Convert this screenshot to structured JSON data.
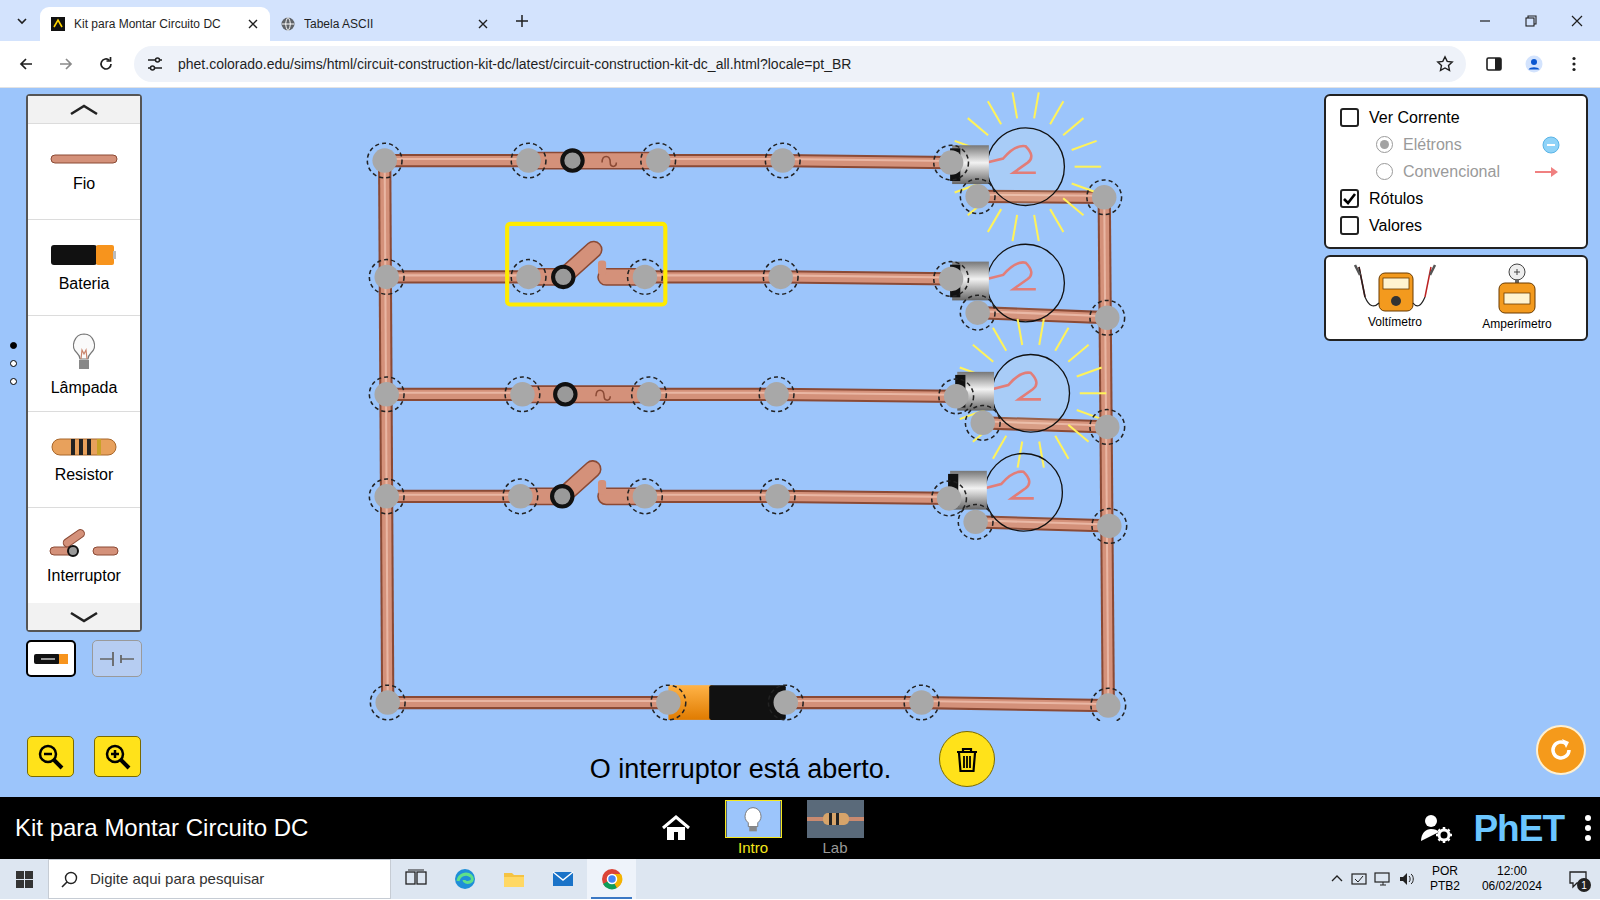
{
  "window": {
    "title": "Kit para Montar Circuito DC"
  },
  "tabs": [
    {
      "label": "Kit para Montar Circuito DC",
      "selected": true,
      "kind": "phet"
    },
    {
      "label": "Tabela ASCII",
      "selected": false,
      "kind": "globe"
    }
  ],
  "address_bar": {
    "url": "phet.colorado.edu/sims/html/circuit-construction-kit-dc/latest/circuit-construction-kit-dc_all.html?locale=pt_BR",
    "bookmarked": false
  },
  "toolbox": {
    "items": [
      {
        "label": "Fio",
        "kind": "wire"
      },
      {
        "label": "Bateria",
        "kind": "battery"
      },
      {
        "label": "Lâmpada",
        "kind": "bulb"
      },
      {
        "label": "Resistor",
        "kind": "resistor"
      },
      {
        "label": "Interruptor",
        "kind": "switch"
      }
    ],
    "pages": [
      {
        "selected": true
      },
      {
        "selected": false
      },
      {
        "selected": false
      }
    ],
    "views": [
      {
        "kind": "lifelike",
        "selected": true
      },
      {
        "kind": "schematic",
        "selected": false
      }
    ]
  },
  "circuit": {
    "branches": [
      {
        "switch_closed": true,
        "switch_selected": false,
        "bulb_lit": true
      },
      {
        "switch_closed": false,
        "switch_selected": true,
        "bulb_lit": false
      },
      {
        "switch_closed": true,
        "switch_selected": false,
        "bulb_lit": true
      },
      {
        "switch_closed": false,
        "switch_selected": false,
        "bulb_lit": false
      }
    ]
  },
  "status": "O interruptor está aberto.",
  "controls": {
    "show_current": {
      "label": "Ver Corrente",
      "checked": false
    },
    "current_types": [
      {
        "label": "Elétrons",
        "selected": true,
        "disabled": true,
        "kind": "electron"
      },
      {
        "label": "Convencional",
        "selected": false,
        "disabled": true,
        "kind": "conventional"
      }
    ],
    "checkboxes": [
      {
        "label": "Rótulos",
        "checked": true
      },
      {
        "label": "Valores",
        "checked": false
      }
    ]
  },
  "meters": [
    {
      "label": "Voltímetro",
      "kind": "voltmeter"
    },
    {
      "label": "Amperímetro",
      "kind": "ammeter"
    }
  ],
  "sim_navbar": {
    "title": "Kit para Montar Circuito DC",
    "screens": [
      {
        "label": "Intro",
        "selected": true,
        "kind": "intro"
      },
      {
        "label": "Lab",
        "selected": false,
        "kind": "lab"
      }
    ],
    "logo": "PhET"
  },
  "taskbar": {
    "search_placeholder": "Digite aqui para pesquisar",
    "apps": [
      {
        "kind": "task-view",
        "active": false
      },
      {
        "kind": "edge",
        "active": false
      },
      {
        "kind": "explorer",
        "active": false
      },
      {
        "kind": "mail",
        "active": false
      },
      {
        "kind": "chrome",
        "active": true
      }
    ],
    "language": "POR",
    "layout": "PTB2",
    "time": "12:00",
    "date": "06/02/2024",
    "notifications": "1"
  }
}
